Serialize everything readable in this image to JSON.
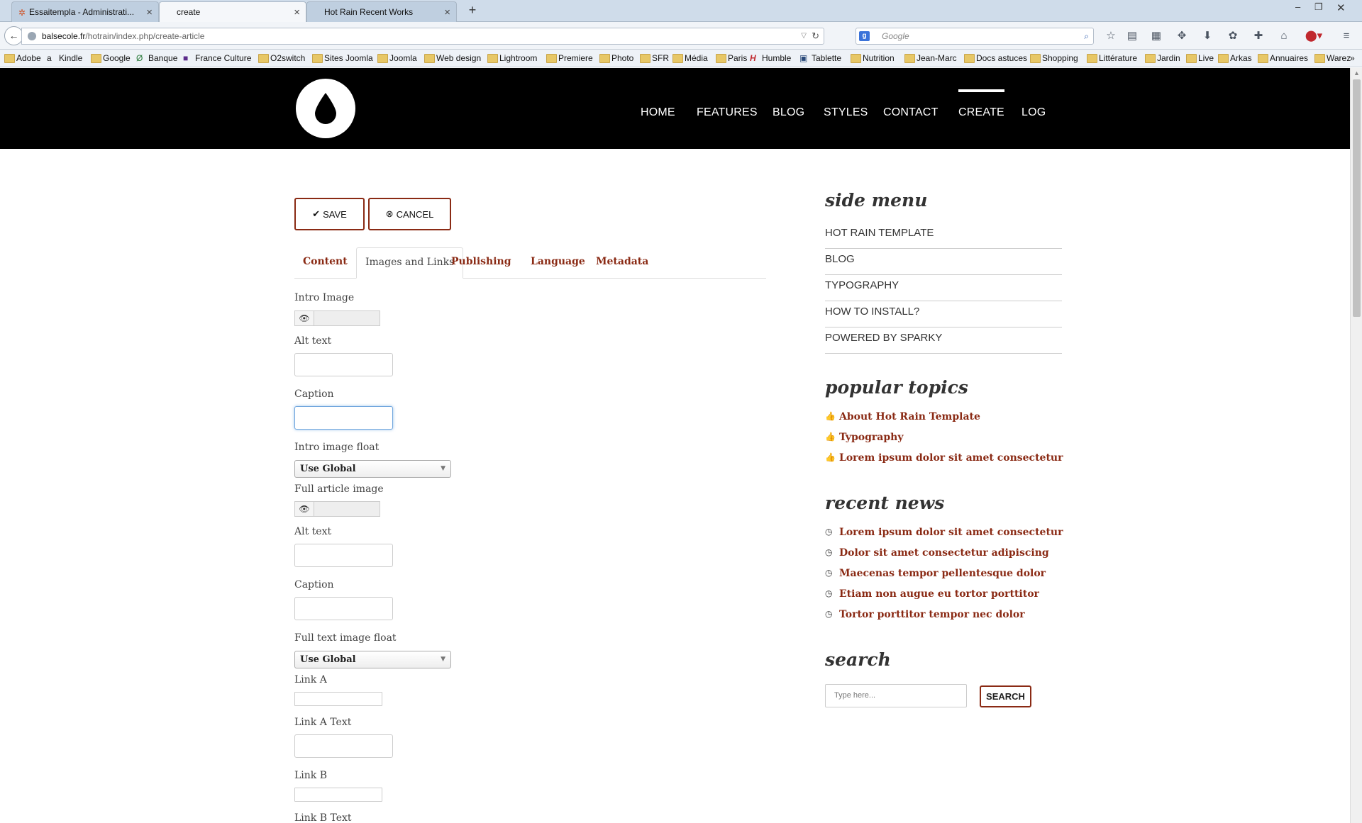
{
  "browser": {
    "tabs": [
      {
        "title": "Essaitempla - Administrati..."
      },
      {
        "title": "create"
      },
      {
        "title": "Hot Rain Recent Works"
      }
    ],
    "url_host": "balsecole.fr",
    "url_path": "/hotrain/index.php/create-article",
    "search_placeholder": "Google",
    "bookmarks": [
      "Adobe",
      "Kindle",
      "Google",
      "Banque",
      "France Culture",
      "O2switch",
      "Sites Joomla",
      "Joomla",
      "Web design",
      "Lightroom",
      "Premiere",
      "Photo",
      "SFR",
      "Média",
      "Paris",
      "Humble",
      "Tablette",
      "Nutrition",
      "Jean-Marc",
      "Docs astuces",
      "Shopping",
      "Littérature",
      "Jardin",
      "Live",
      "Arkas",
      "Annuaires",
      "Warez"
    ],
    "bookmarks_overflow": "»"
  },
  "site": {
    "nav": [
      "HOME",
      "FEATURES",
      "BLOG",
      "STYLES",
      "CONTACT",
      "CREATE",
      "LOG"
    ],
    "active_nav": "CREATE"
  },
  "form": {
    "save_label": "SAVE",
    "cancel_label": "CANCEL",
    "tabs": [
      "Content",
      "Images and Links",
      "Publishing",
      "Language",
      "Metadata"
    ],
    "active_tab": "Images and Links",
    "fields": {
      "intro_image": "Intro Image",
      "alt_text_1": "Alt text",
      "caption_1": "Caption",
      "intro_float": "Intro image float",
      "intro_float_value": "Use Global",
      "full_image": "Full article image",
      "alt_text_2": "Alt text",
      "caption_2": "Caption",
      "full_float": "Full text image float",
      "full_float_value": "Use Global",
      "link_a": "Link A",
      "link_a_text": "Link A Text",
      "link_b": "Link B",
      "link_b_text": "Link B Text"
    }
  },
  "sidebar": {
    "menu_title": "side menu",
    "menu": [
      "HOT RAIN TEMPLATE",
      "BLOG",
      "TYPOGRAPHY",
      "HOW TO INSTALL?",
      "POWERED BY SPARKY"
    ],
    "popular_title": "popular topics",
    "popular": [
      "About Hot Rain Template",
      "Typography",
      "Lorem ipsum dolor sit amet consectetur"
    ],
    "news_title": "recent news",
    "news": [
      "Lorem ipsum dolor sit amet consectetur",
      "Dolor sit amet consectetur adipiscing",
      "Maecenas tempor pellentesque dolor",
      "Etiam non augue eu tortor porttitor",
      "Tortor porttitor tempor nec dolor"
    ],
    "search_title": "search",
    "search_placeholder": "Type here...",
    "search_button": "SEARCH"
  },
  "colors": {
    "accent": "#8a2a14",
    "header": "#000000"
  }
}
